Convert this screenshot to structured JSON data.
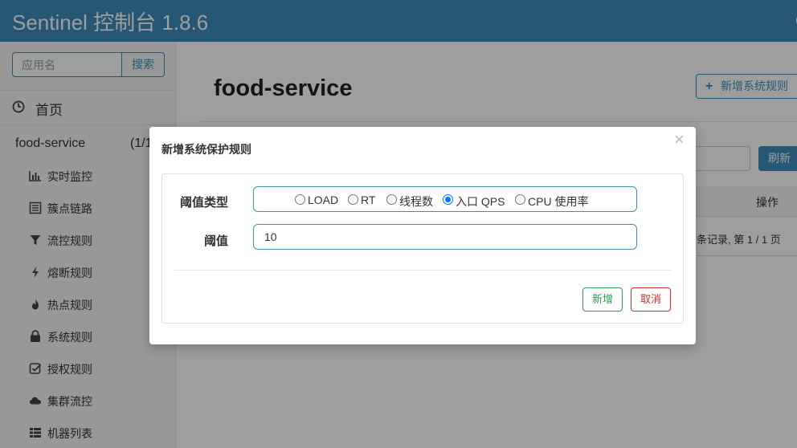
{
  "header": {
    "brand": "Sentinel 控制台 1.8.6",
    "right_fragment": "c"
  },
  "sidebar": {
    "search_placeholder": "应用名",
    "search_button": "搜索",
    "home_label": "首页",
    "app_name": "food-service",
    "app_count": "(1/1",
    "items": [
      {
        "label": "实时监控",
        "icon": "bar-chart-icon"
      },
      {
        "label": "簇点链路",
        "icon": "list-icon"
      },
      {
        "label": "流控规则",
        "icon": "filter-icon"
      },
      {
        "label": "熔断规则",
        "icon": "lightning-icon"
      },
      {
        "label": "热点规则",
        "icon": "fire-icon"
      },
      {
        "label": "系统规则",
        "icon": "lock-icon"
      },
      {
        "label": "授权规则",
        "icon": "check-square-icon"
      },
      {
        "label": "集群流控",
        "icon": "cloud-icon"
      },
      {
        "label": "机器列表",
        "icon": "th-list-icon"
      }
    ]
  },
  "main": {
    "page_title": "food-service",
    "add_rule_button": "新增系统规则",
    "refresh_button": "刷新",
    "table_op_header": "操作",
    "pager_text": "条记录, 第 1 / 1 页"
  },
  "modal": {
    "title": "新增系统保护规则",
    "threshold_type_label": "阈值类型",
    "threshold_label": "阈值",
    "options": [
      "LOAD",
      "RT",
      "线程数",
      "入口 QPS",
      "CPU 使用率"
    ],
    "selected_option": "入口 QPS",
    "threshold_value": "10",
    "add_button": "新增",
    "cancel_button": "取消",
    "close_symbol": "×"
  },
  "colors": {
    "header_bg": "#3c8dbc",
    "primary": "#3c8dbc",
    "success": "#2e9e4f",
    "danger": "#c9302c",
    "radio_checked": "#0075ff"
  }
}
